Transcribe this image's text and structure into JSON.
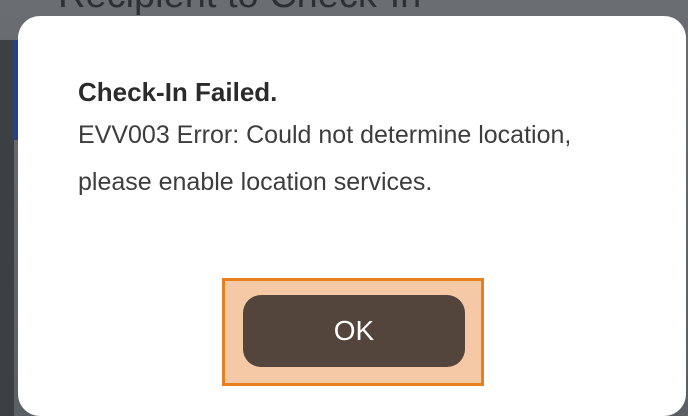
{
  "background": {
    "heading_fragment": "Recipient to Check-In"
  },
  "dialog": {
    "title": "Check-In Failed.",
    "message": "EVV003 Error: Could not determine location, please enable location services.",
    "ok_label": "OK"
  },
  "colors": {
    "button_bg": "#53453c",
    "highlight_fill": "#f6c9a6",
    "highlight_border": "#e8801f"
  }
}
